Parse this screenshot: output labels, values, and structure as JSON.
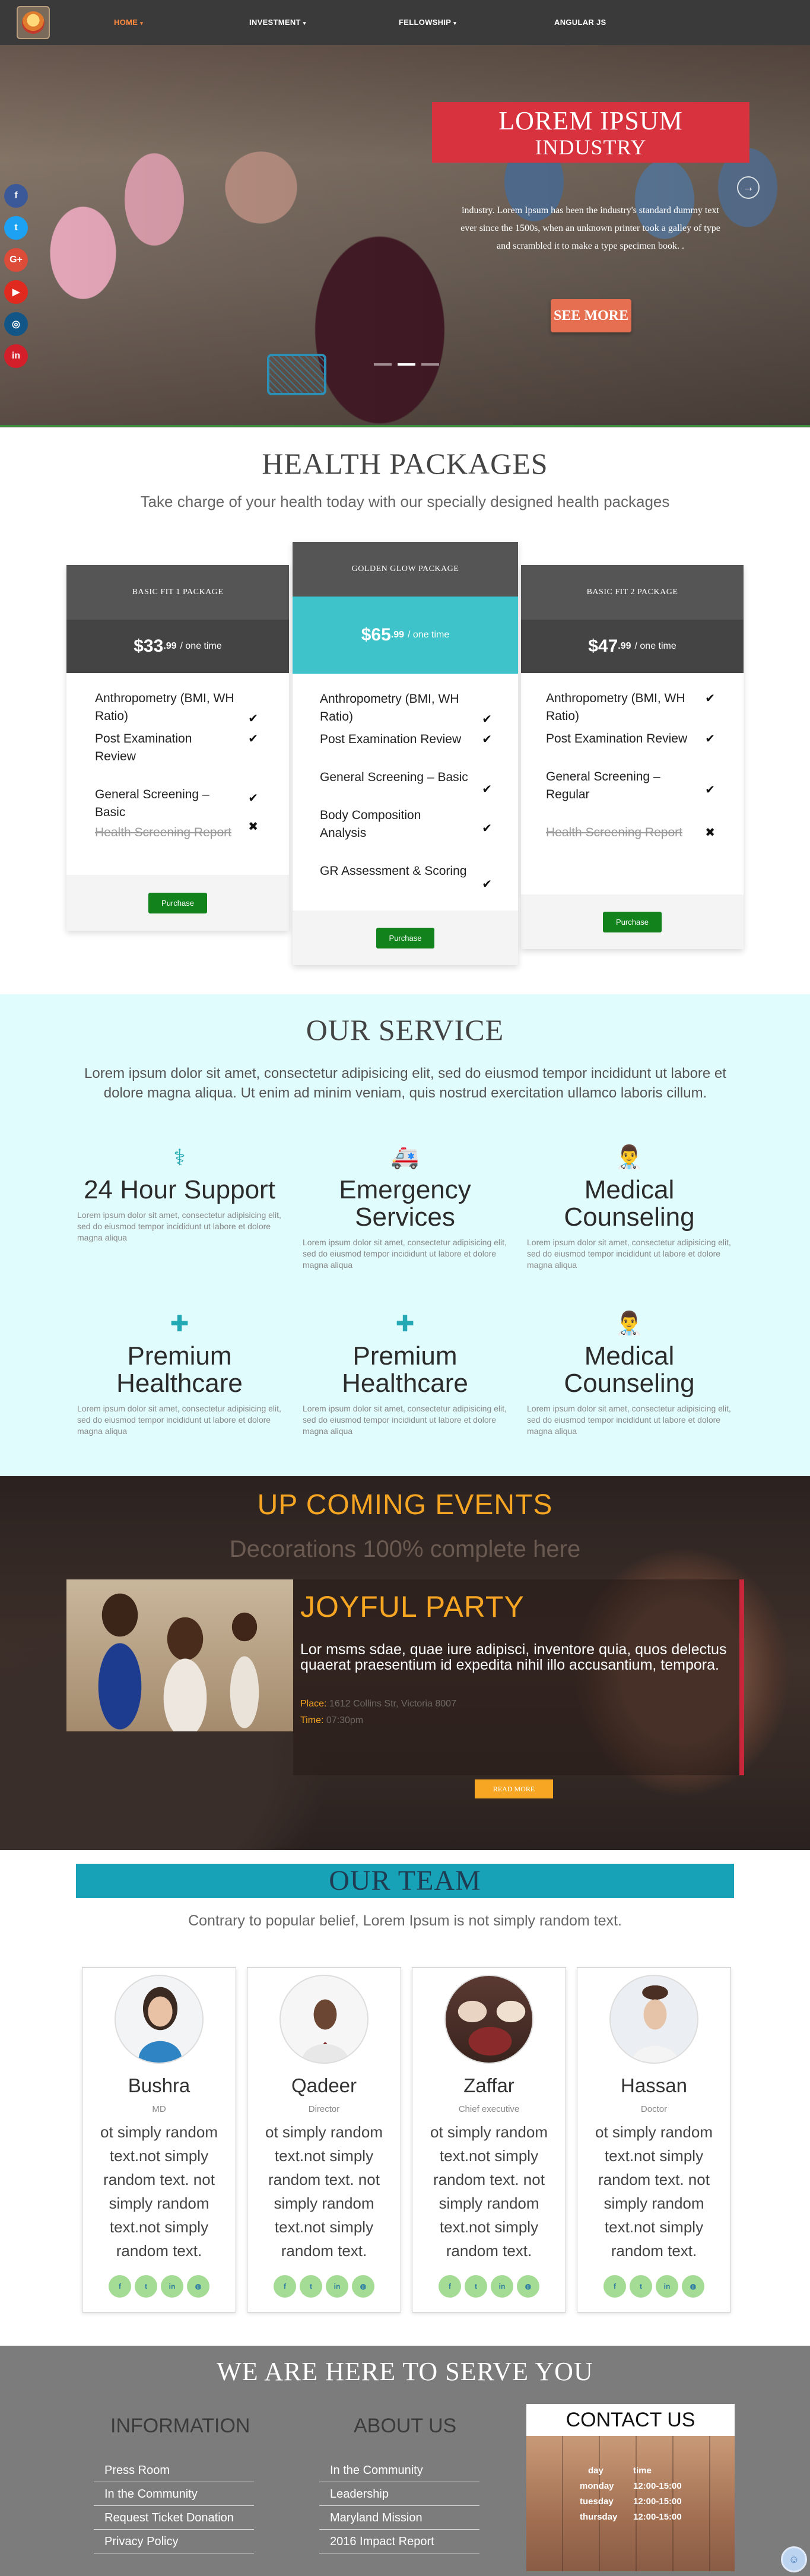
{
  "nav": {
    "items": [
      {
        "label": "HOME",
        "caret": "▾"
      },
      {
        "label": "INVESTMENT",
        "caret": "▾"
      },
      {
        "label": "FELLOWSHIP",
        "caret": "▾"
      },
      {
        "label": "ANGULAR JS",
        "caret": ""
      }
    ]
  },
  "social": [
    {
      "icon": "facebook-icon",
      "glyph": "f",
      "color": "#3b5998"
    },
    {
      "icon": "twitter-icon",
      "glyph": "t",
      "color": "#1da1f2"
    },
    {
      "icon": "google-plus-icon",
      "glyph": "G+",
      "color": "#dd4b39"
    },
    {
      "icon": "youtube-icon",
      "glyph": "▶",
      "color": "#e02a20"
    },
    {
      "icon": "instagram-icon",
      "glyph": "◎",
      "color": "#125688"
    },
    {
      "icon": "linkedin-icon",
      "glyph": "in",
      "color": "#d21f2a"
    }
  ],
  "hero": {
    "title_line1": "LOREM IPSUM",
    "title_line2": "INDUSTRY",
    "text": "industry. Lorem Ipsum has been the industry's standard dummy text ever since the 1500s, when an unknown printer took a galley of type and scrambled it to make a type specimen book. .",
    "button": "SEE MORE",
    "arrow": "→"
  },
  "packages": {
    "title": "HEALTH PACKAGES",
    "subtitle": "Take charge of your health today with our specially designed health packages",
    "items": [
      {
        "name": "BASIC FIT 1 PACKAGE",
        "price": "$33",
        "cents": ".99",
        "per": "/ one time",
        "price_color": "#444444",
        "features": [
          {
            "text": "Anthropometry (BMI, WH Ratio)",
            "mark": "✔",
            "strike": false
          },
          {
            "text": "Post Examination Review",
            "mark": "✔",
            "strike": false
          },
          {
            "text": "General Screening – Basic",
            "mark": "✔",
            "strike": false
          },
          {
            "text": "Health Screening Report",
            "mark": "✖",
            "strike": true
          }
        ],
        "button": "Purchase"
      },
      {
        "name": "GOLDEN GLOW PACKAGE",
        "price": "$65",
        "cents": ".99",
        "per": "/ one time",
        "price_color": "#3dc3c9",
        "features": [
          {
            "text": "Anthropometry (BMI, WH Ratio)",
            "mark": "✔",
            "strike": false
          },
          {
            "text": "Post Examination Review",
            "mark": "✔",
            "strike": false
          },
          {
            "text": "General Screening – Basic",
            "mark": "✔",
            "strike": false
          },
          {
            "text": "Body Composition Analysis",
            "mark": "✔",
            "strike": false
          },
          {
            "text": "GR Assessment & Scoring",
            "mark": "✔",
            "strike": false
          }
        ],
        "button": "Purchase"
      },
      {
        "name": "BASIC FIT 2 PACKAGE",
        "price": "$47",
        "cents": ".99",
        "per": "/ one time",
        "price_color": "#444444",
        "features": [
          {
            "text": "Anthropometry (BMI, WH Ratio)",
            "mark": "✔",
            "strike": false
          },
          {
            "text": "Post Examination Review",
            "mark": "✔",
            "strike": false
          },
          {
            "text": "General Screening – Regular",
            "mark": "✔",
            "strike": false
          },
          {
            "text": "Health Screening Report",
            "mark": "✖",
            "strike": true
          }
        ],
        "button": "Purchase"
      }
    ]
  },
  "services": {
    "title": "OUR SERVICE",
    "intro": "Lorem ipsum dolor sit amet, consectetur adipisicing elit, sed do eiusmod tempor incididunt ut labore et dolore magna aliqua. Ut enim ad minim veniam, quis nostrud exercitation ullamco laboris cillum.",
    "items": [
      {
        "icon": "stethoscope-icon",
        "glyph": "⚕",
        "title": "24 Hour Support",
        "text": "Lorem ipsum dolor sit amet, consectetur adipisicing elit, sed do eiusmod tempor incididunt ut labore et dolore magna aliqua"
      },
      {
        "icon": "ambulance-icon",
        "glyph": "🚑",
        "title": "Emergency Services",
        "text": "Lorem ipsum dolor sit amet, consectetur adipisicing elit, sed do eiusmod tempor incididunt ut labore et dolore magna aliqua"
      },
      {
        "icon": "doctor-icon",
        "glyph": "👨‍⚕️",
        "title": "Medical Counseling",
        "text": "Lorem ipsum dolor sit amet, consectetur adipisicing elit, sed do eiusmod tempor incididunt ut labore et dolore magna aliqua"
      },
      {
        "icon": "medkit-icon",
        "glyph": "✚",
        "title": "Premium Healthcare",
        "text": "Lorem ipsum dolor sit amet, consectetur adipisicing elit, sed do eiusmod tempor incididunt ut labore et dolore magna aliqua"
      },
      {
        "icon": "medkit-icon",
        "glyph": "✚",
        "title": "Premium Healthcare",
        "text": "Lorem ipsum dolor sit amet, consectetur adipisicing elit, sed do eiusmod tempor incididunt ut labore et dolore magna aliqua"
      },
      {
        "icon": "doctor-icon",
        "glyph": "👨‍⚕️",
        "title": "Medical Counseling",
        "text": "Lorem ipsum dolor sit amet, consectetur adipisicing elit, sed do eiusmod tempor incididunt ut labore et dolore magna aliqua"
      }
    ]
  },
  "events": {
    "title": "UP COMING EVENTS",
    "subtitle": "Decorations 100% complete here",
    "event_title": "JOYFUL PARTY",
    "event_text": "Lor msms sdae, quae iure adipisci, inventore quia, quos delectus quaerat praesentium id expedita nihil illo accusantium, tempora.",
    "place_label": "Place:",
    "place": "1612 Collins Str, Victoria 8007",
    "time_label": "Time:",
    "time": "07:30pm",
    "button": "READ MORE"
  },
  "team": {
    "title": "OUR TEAM",
    "subtitle": "Contrary to popular belief, Lorem Ipsum is not simply random text.",
    "members": [
      {
        "name": "Bushra",
        "role": "MD",
        "text": "ot simply random text.not simply random text. not simply random text.not simply random text."
      },
      {
        "name": "Qadeer",
        "role": "Director",
        "text": "ot simply random text.not simply random text. not simply random text.not simply random text."
      },
      {
        "name": "Zaffar",
        "role": "Chief executive",
        "text": "ot simply random text.not simply random text. not simply random text.not simply random text."
      },
      {
        "name": "Hassan",
        "role": "Doctor",
        "text": "ot simply random text.not simply random text. not simply random text.not simply random text."
      }
    ],
    "social": [
      {
        "icon": "facebook-icon",
        "glyph": "f"
      },
      {
        "icon": "twitter-icon",
        "glyph": "t"
      },
      {
        "icon": "linkedin-icon",
        "glyph": "in"
      },
      {
        "icon": "globe-icon",
        "glyph": "◍"
      }
    ]
  },
  "footer": {
    "title": "WE ARE HERE TO SERVE YOU",
    "info_title": "INFORMATION",
    "info_links": [
      "Press Room",
      "In the Community",
      "Request Ticket Donation",
      "Privacy Policy"
    ],
    "about_title": "ABOUT US",
    "about_links": [
      "In the Community",
      "Leadership",
      "Maryland Mission",
      "2016 Impact Report"
    ],
    "contact_title": "CONTACT US",
    "hours_header": [
      "day",
      "time"
    ],
    "hours": [
      [
        "monday",
        "12:00-15:00"
      ],
      [
        "tuesday",
        "12:00-15:00"
      ],
      [
        "thursday",
        "12:00-15:00"
      ]
    ]
  }
}
